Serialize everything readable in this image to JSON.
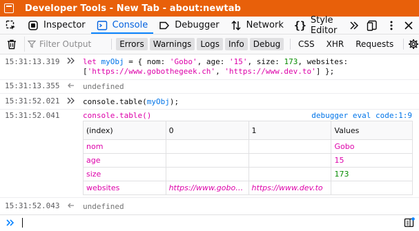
{
  "window": {
    "title": "Developer Tools - New Tab - about:newtab"
  },
  "tabs": [
    {
      "label": "Inspector",
      "selected": false
    },
    {
      "label": "Console",
      "selected": true
    },
    {
      "label": "Debugger",
      "selected": false
    },
    {
      "label": "Network",
      "selected": false
    },
    {
      "label": "Style Editor",
      "selected": false
    }
  ],
  "filter": {
    "placeholder": "Filter Output",
    "levels": [
      "Errors",
      "Warnings",
      "Logs",
      "Info",
      "Debug"
    ],
    "types": [
      "CSS",
      "XHR",
      "Requests"
    ]
  },
  "console": {
    "entries": [
      {
        "time": "15:31:13.319",
        "line1_prefix": "let ",
        "line1_var": "myObj",
        "line1_rest": " = { nom: ",
        "line1_s1": "'Gobo'",
        "line1_m1": ", age: ",
        "line1_s2": "'15'",
        "line1_m2": ", size: ",
        "line1_n1": "173",
        "line1_m3": ", websites:",
        "line2_open": "[",
        "line2_s1": "'https://www.gobothegeek.ch'",
        "line2_m": ", ",
        "line2_s2": "'https://www.dev.to'",
        "line2_close": "] };"
      },
      {
        "time": "15:31:13.355",
        "result": "undefined"
      },
      {
        "time": "15:31:52.021",
        "call_fn": "console",
        "call_rest": ".table(",
        "call_arg": "myObj",
        "call_end": ");"
      },
      {
        "time": "15:31:52.041",
        "output": "console.table()",
        "source": "debugger eval code:1:9"
      },
      {
        "time": "15:31:52.043",
        "result": "undefined"
      }
    ],
    "table": {
      "headers": [
        "(index)",
        "0",
        "1",
        "Values"
      ],
      "rows": [
        {
          "index": "nom",
          "c0": "",
          "c1": "",
          "value": "Gobo"
        },
        {
          "index": "age",
          "c0": "",
          "c1": "",
          "value": "15"
        },
        {
          "index": "size",
          "c0": "",
          "c1": "",
          "value": "173"
        },
        {
          "index": "websites",
          "c0": "https://www.gobo…",
          "c1": "https://www.dev.to",
          "value": ""
        }
      ]
    }
  },
  "colors": {
    "titlebar": "#e8600a",
    "accent": "#0a84ff",
    "string": "#dd00a9",
    "number": "#058b00"
  }
}
